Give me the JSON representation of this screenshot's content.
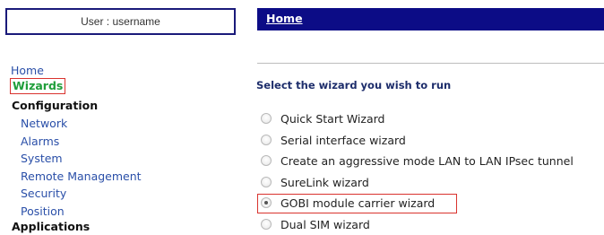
{
  "user_box": {
    "text": "User : username"
  },
  "sidebar": {
    "home": "Home",
    "wizards": "Wizards",
    "configuration": "Configuration",
    "config_items": [
      "Network",
      "Alarms",
      "System",
      "Remote Management",
      "Security",
      "Position"
    ],
    "applications": "Applications"
  },
  "header": {
    "breadcrumb": "Home"
  },
  "main": {
    "prompt": "Select the wizard you wish to run",
    "options": [
      {
        "label": "Quick Start Wizard",
        "selected": false
      },
      {
        "label": "Serial interface wizard",
        "selected": false
      },
      {
        "label": "Create an aggressive mode LAN to LAN IPsec tunnel",
        "selected": false
      },
      {
        "label": "SureLink wizard",
        "selected": false
      },
      {
        "label": "GOBI module carrier wizard",
        "selected": true
      },
      {
        "label": "Dual SIM wizard",
        "selected": false
      }
    ]
  },
  "colors": {
    "header_bg": "#0c0c86",
    "link": "#2a4fa8",
    "active_nav": "#1f9e3a",
    "highlight_border": "#d9332e"
  }
}
